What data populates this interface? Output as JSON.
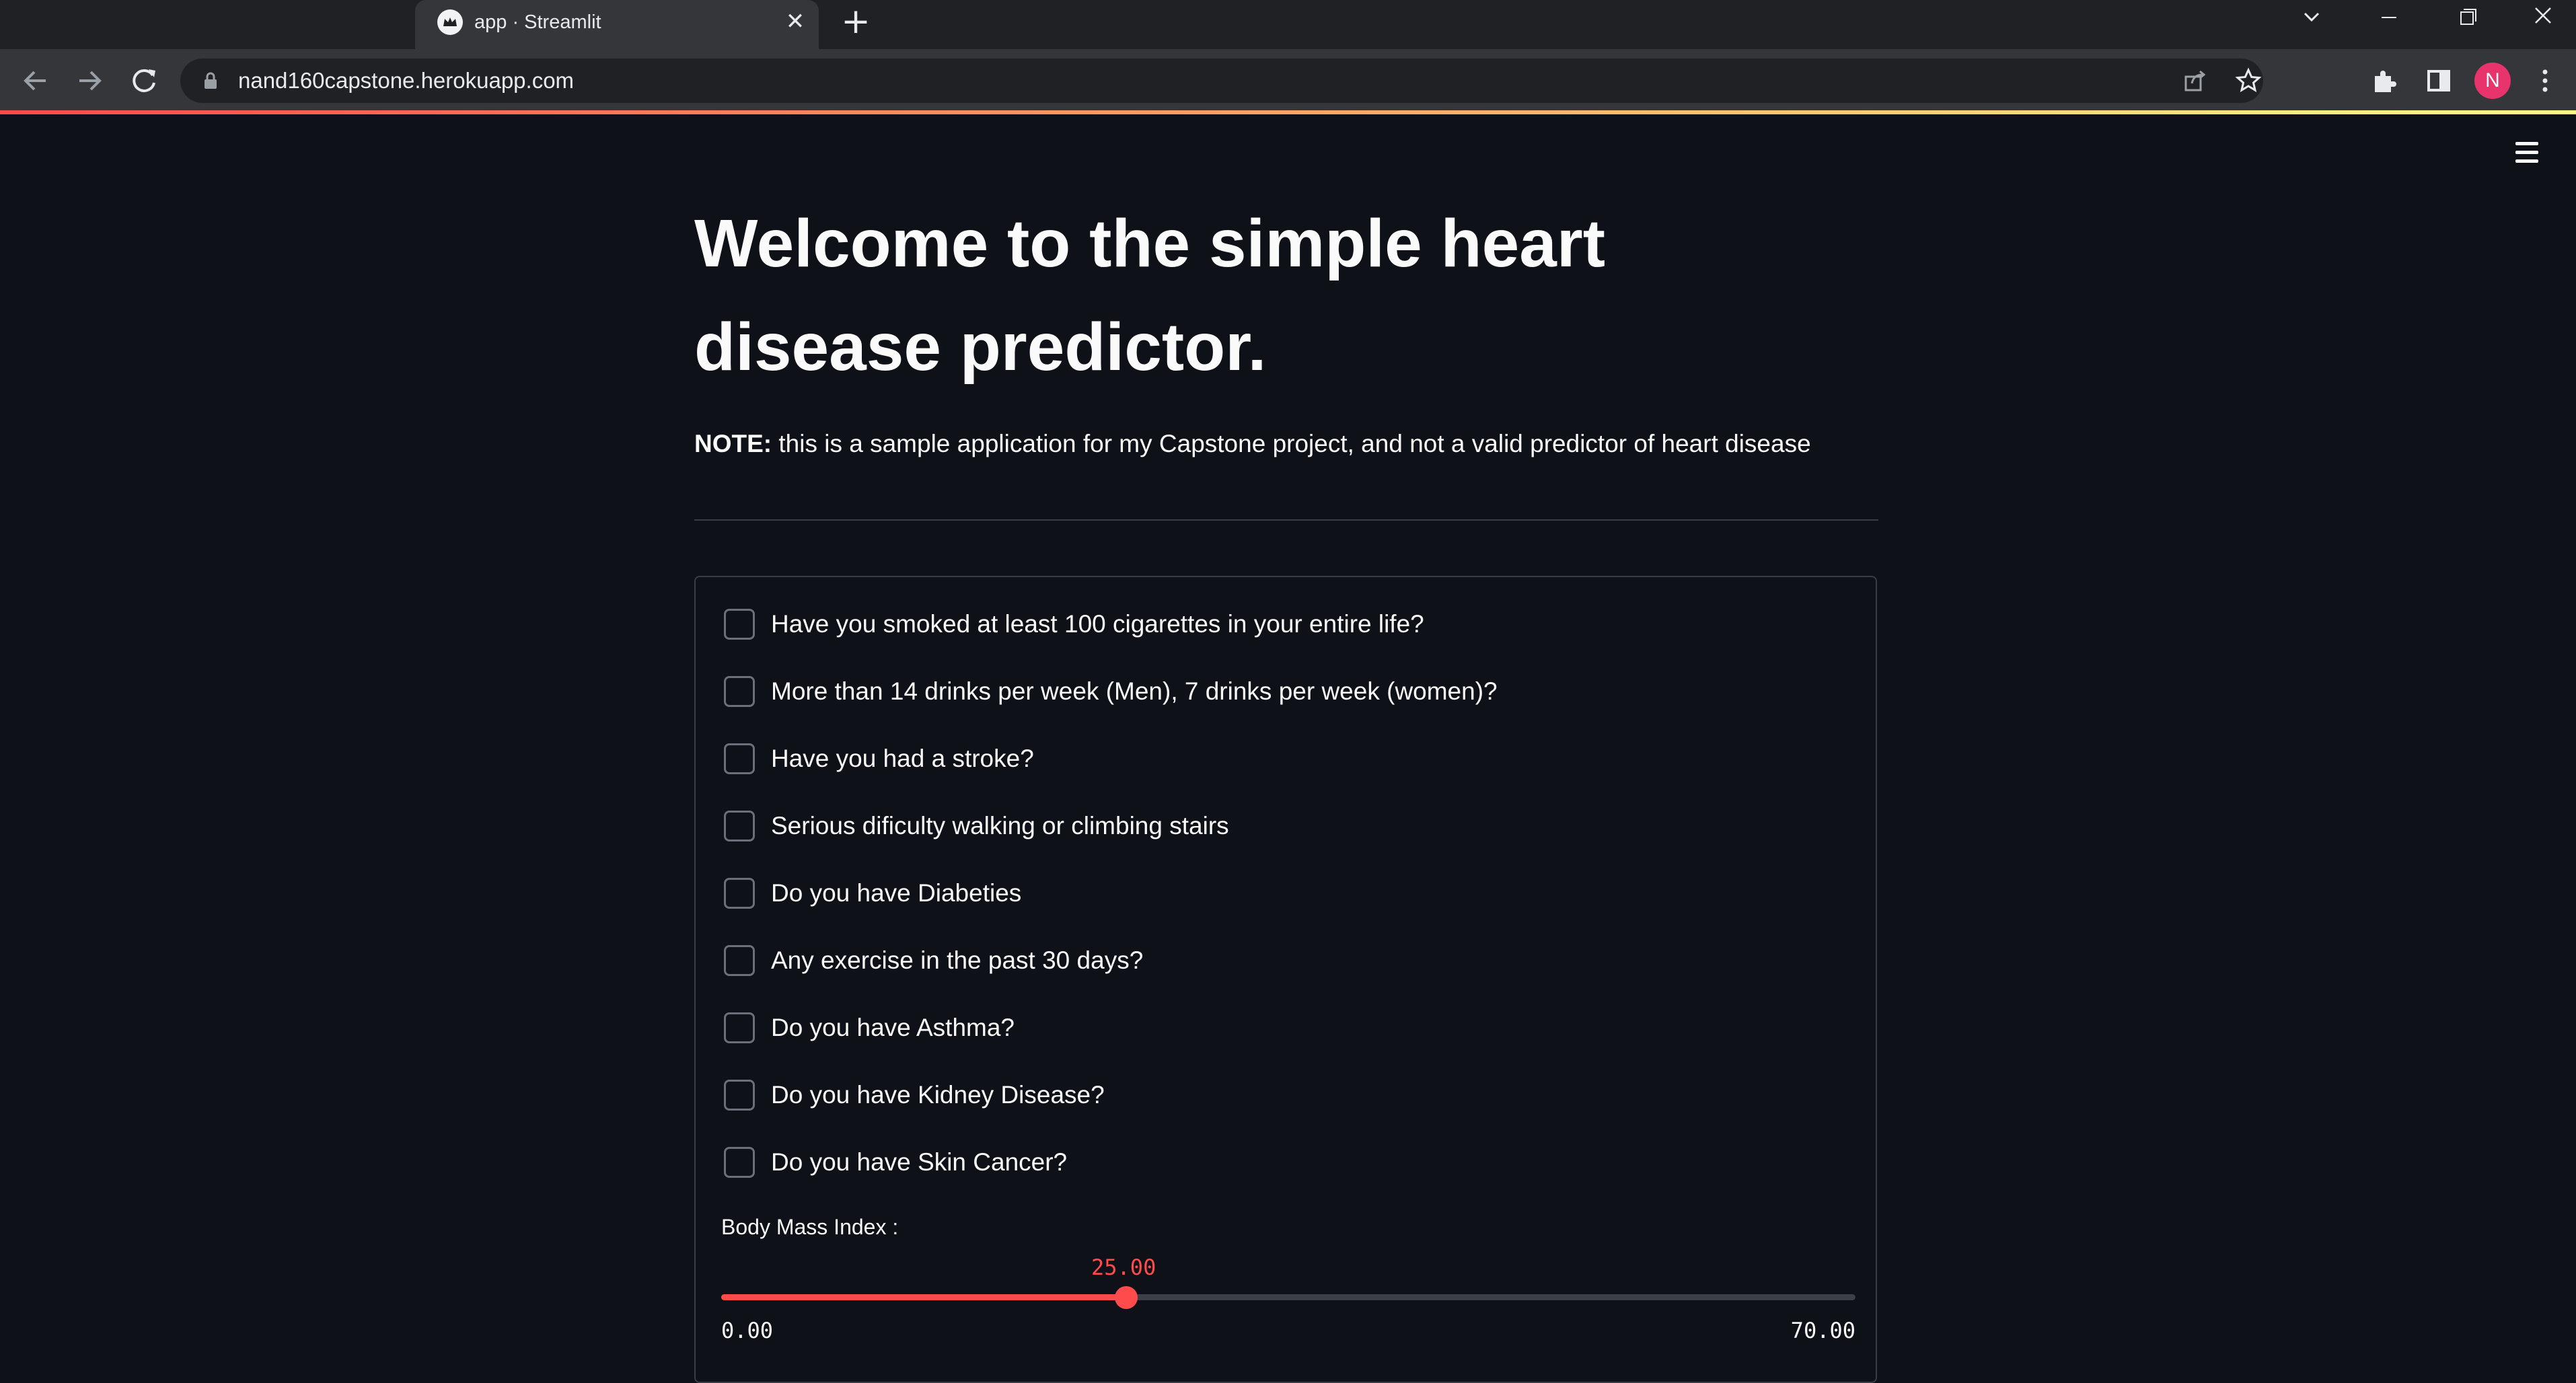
{
  "browser": {
    "tab": {
      "title": "app · Streamlit",
      "favicon": "streamlit-crown-icon"
    },
    "url": "nand160capstone.herokuapp.com",
    "profile_initial": "N",
    "accent": "#e8336d"
  },
  "page": {
    "title": "Welcome to the simple heart disease predictor.",
    "note_label": "NOTE:",
    "note_text": " this is a sample application for my Capstone project, and not a valid predictor of heart disease"
  },
  "form": {
    "checkboxes": [
      {
        "label": "Have you smoked at least 100 cigarettes in your entire life?",
        "checked": false
      },
      {
        "label": "More than 14 drinks per week (Men), 7 drinks per week (women)?",
        "checked": false
      },
      {
        "label": "Have you had a stroke?",
        "checked": false
      },
      {
        "label": "Serious dificulty walking or climbing stairs",
        "checked": false
      },
      {
        "label": "Do you have Diabeties",
        "checked": false
      },
      {
        "label": "Any exercise in the past 30 days?",
        "checked": false
      },
      {
        "label": "Do you have Asthma?",
        "checked": false
      },
      {
        "label": "Do you have Kidney Disease?",
        "checked": false
      },
      {
        "label": "Do you have Skin Cancer?",
        "checked": false
      }
    ],
    "bmi_slider": {
      "label": "Body Mass Index :",
      "value": 25.0,
      "value_text": "25.00",
      "min": 0.0,
      "max": 70.0,
      "min_text": "0.00",
      "max_text": "70.00",
      "accent": "#ff4b4b"
    }
  }
}
